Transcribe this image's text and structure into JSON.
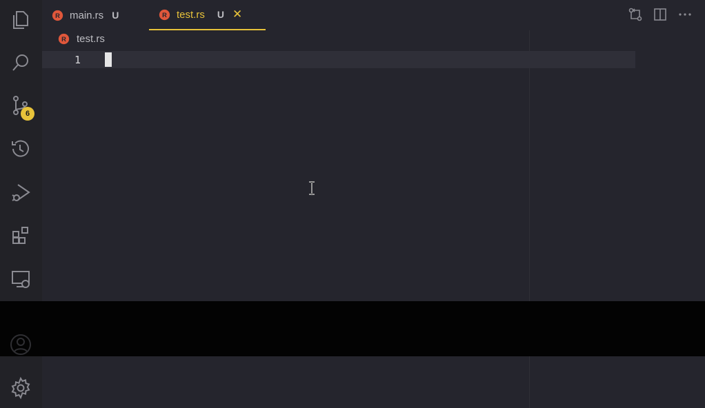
{
  "tabs": [
    {
      "label": "main.rs",
      "status": "U"
    },
    {
      "label": "test.rs",
      "status": "U",
      "close": "✕"
    }
  ],
  "breadcrumb": {
    "file": "test.rs"
  },
  "editor": {
    "line_number": "1"
  },
  "activity_bar": {
    "source_control_badge": "6",
    "icons": [
      "files-icon",
      "search-icon",
      "source-control-icon",
      "timeline-icon",
      "run-debug-icon",
      "extensions-icon",
      "remote-explorer-icon",
      "account-icon",
      "settings-icon"
    ]
  },
  "colors": {
    "accent": "#e8c33a",
    "rust": "#e0573b",
    "background": "#25252d"
  }
}
